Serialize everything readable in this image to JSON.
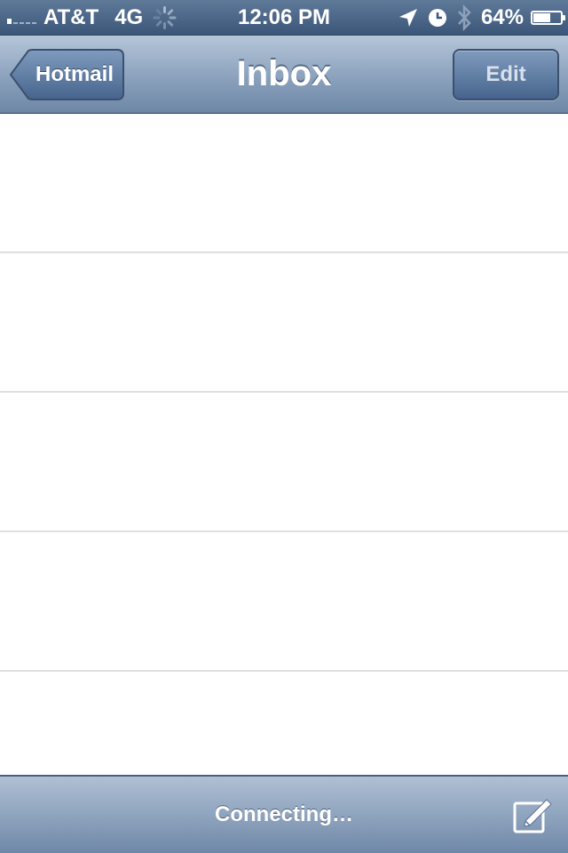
{
  "status_bar": {
    "carrier": "AT&T",
    "network": "4G",
    "time": "12:06 PM",
    "battery_percent_text": "64%",
    "battery_level": 0.64,
    "signal_bars_on": 1,
    "icons": [
      "signal-icon",
      "activity-spinner-icon",
      "location-arrow-icon",
      "alarm-clock-icon",
      "bluetooth-icon",
      "battery-charging-icon"
    ]
  },
  "nav_bar": {
    "back_label": "Hotmail",
    "title": "Inbox",
    "edit_label": "Edit"
  },
  "list": {
    "rows": [
      "",
      "",
      "",
      "",
      ""
    ]
  },
  "toolbar": {
    "status": "Connecting…",
    "compose_icon": "compose-icon"
  },
  "colors": {
    "status_bar": "#3c5679",
    "nav_bar": "#8ea4bf",
    "edit_button": "#47648d",
    "separator": "#e0e0e0",
    "toolbar": "#8fa4be"
  }
}
